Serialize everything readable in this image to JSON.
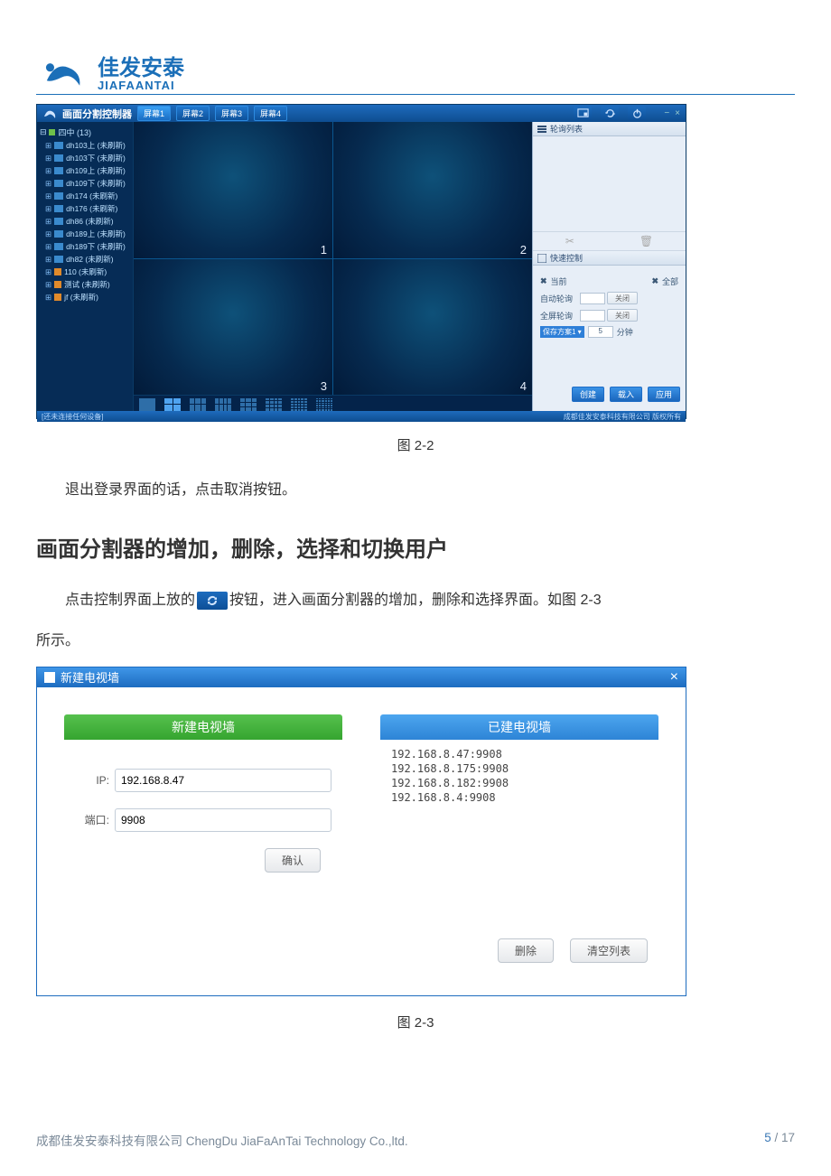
{
  "brand": {
    "cn": "佳发安泰",
    "en": "JIAFAANTAI"
  },
  "fig22": {
    "app_title": "画面分割控制器",
    "tabs": [
      "屏幕1",
      "屏幕2",
      "屏幕3",
      "屏幕4"
    ],
    "active_tab_index": 0,
    "window_minimize": "−",
    "window_close": "×",
    "device_root": "四中 (13)",
    "devices": [
      {
        "label": "dh103上 (未刷新)",
        "icon": "cam"
      },
      {
        "label": "dh103下 (未刷新)",
        "icon": "cam"
      },
      {
        "label": "dh109上 (未刷新)",
        "icon": "cam"
      },
      {
        "label": "dh109下 (未刷新)",
        "icon": "cam"
      },
      {
        "label": "dh174 (未刷新)",
        "icon": "cam"
      },
      {
        "label": "dh176 (未刷新)",
        "icon": "cam"
      },
      {
        "label": "dh86 (未刷新)",
        "icon": "cam"
      },
      {
        "label": "dh189上 (未刷新)",
        "icon": "cam"
      },
      {
        "label": "dh189下 (未刷新)",
        "icon": "cam"
      },
      {
        "label": "dh82 (未刷新)",
        "icon": "cam"
      },
      {
        "label": "110 (未刷新)",
        "icon": "ora"
      },
      {
        "label": "测试 (未刷新)",
        "icon": "ora"
      },
      {
        "label": "jf (未刷新)",
        "icon": "ora"
      }
    ],
    "pane_nums": [
      "1",
      "2",
      "3",
      "4"
    ],
    "right_loop_title": "轮询列表",
    "right_qc_title": "快速控制",
    "qc_current": "当前",
    "qc_global": "全部",
    "qc_auto_loop": "自动轮询",
    "qc_global_loop": "全屏轮询",
    "qc_close": "关闭",
    "qc_scheme_label": "保存方案",
    "qc_scheme_value": "1",
    "qc_minute": "分钟",
    "qc_interval": "5",
    "btn_create": "创建",
    "btn_import": "载入",
    "btn_apply": "应用",
    "status_left": "[还未连接任何设备]",
    "status_right": "成都佳发安泰科技有限公司 版权所有"
  },
  "caption22": "图 2-2",
  "para1": "退出登录界面的话，点击取消按钮。",
  "heading": "画面分割器的增加，删除，选择和切换用户",
  "para2a": "点击控制界面上放的",
  "para2b": "按钮，进入画面分割器的增加，删除和选择界面。如图 2-3",
  "para2c": "所示。",
  "fig23": {
    "title": "新建电视墙",
    "new_panel_title": "新建电视墙",
    "exist_panel_title": "已建电视墙",
    "ip_label": "IP:",
    "ip_value": "192.168.8.47",
    "port_label": "端口:",
    "port_value": "9908",
    "confirm": "确认",
    "existing": [
      "192.168.8.47:9908",
      "192.168.8.175:9908",
      "192.168.8.182:9908",
      "192.168.8.4:9908"
    ],
    "delete": "删除",
    "clear": "清空列表"
  },
  "caption23": "图 2-3",
  "footer": {
    "company": "成都佳发安泰科技有限公司  ChengDu JiaFaAnTai Technology Co.,ltd.",
    "page_cur": "5",
    "page_sep": " / ",
    "page_total": "17"
  }
}
